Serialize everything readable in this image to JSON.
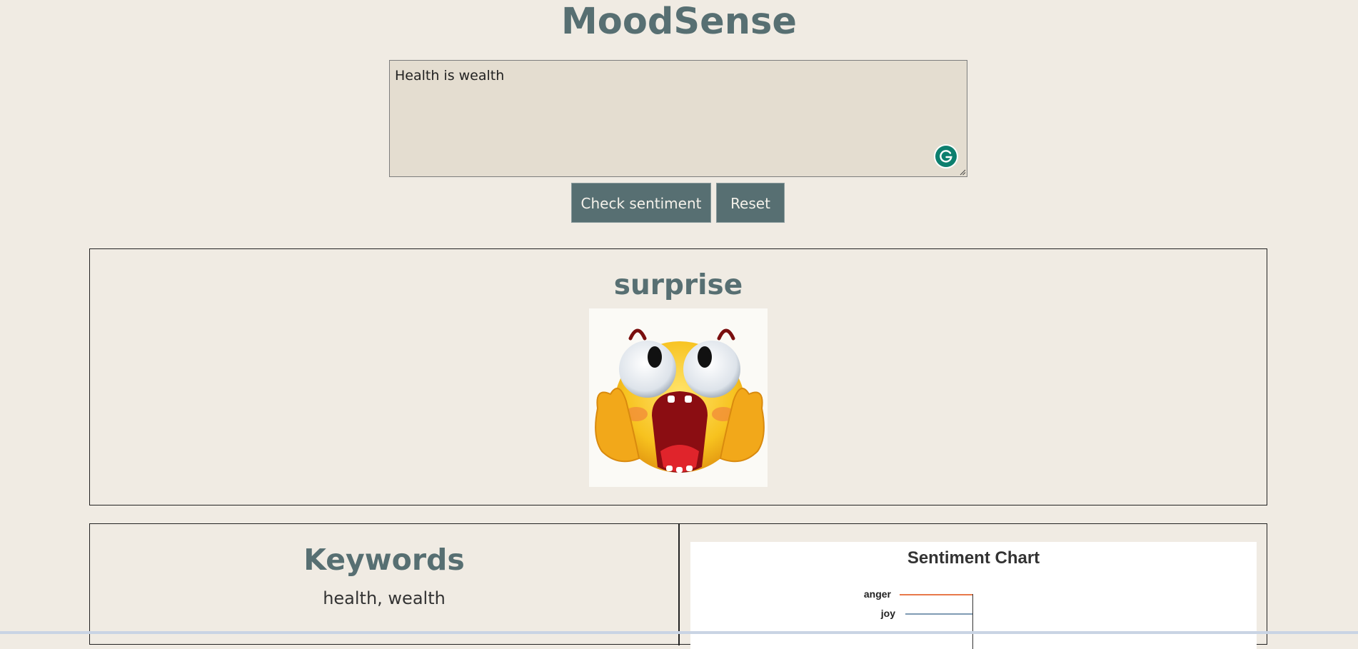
{
  "app": {
    "title": "MoodSense"
  },
  "editor": {
    "value": "Health is wealth"
  },
  "buttons": {
    "check": "Check sentiment",
    "reset": "Reset"
  },
  "result": {
    "emotion": "surprise",
    "emoji_icon": "screaming-surprised-face-icon"
  },
  "keywords": {
    "heading": "Keywords",
    "text": "health, wealth"
  },
  "colors": {
    "accent": "#576f72",
    "background": "#f0ebe3",
    "editor_bg": "#e4ddd0",
    "grammarly": "#0d7f6e"
  },
  "chart_data": {
    "type": "bar",
    "title": "Sentiment Chart",
    "categories": [
      "anger",
      "joy"
    ],
    "series_colors": [
      "#e8794a",
      "#7f9bb3"
    ],
    "note_visible": "bars partially cut off at bottom of viewport"
  }
}
